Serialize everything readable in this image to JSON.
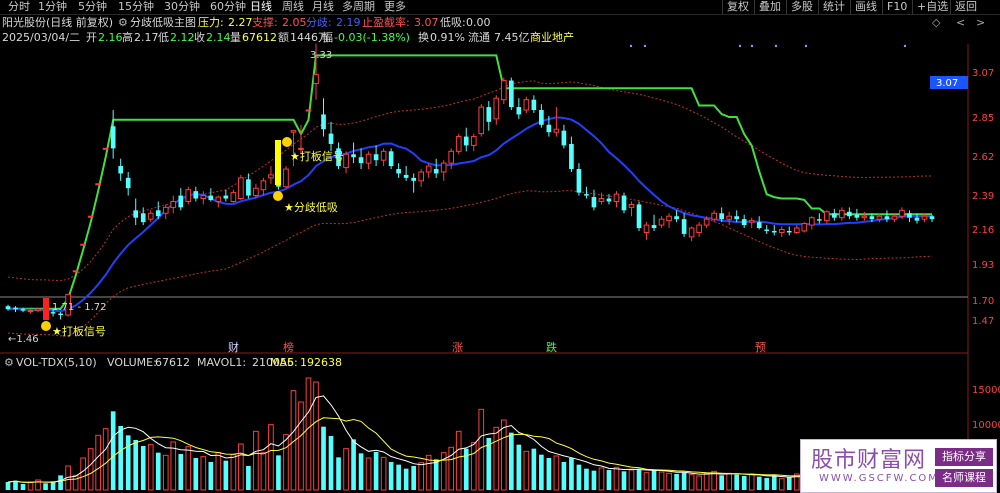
{
  "toolbar": {
    "tabs": [
      "分时",
      "1分钟",
      "5分钟",
      "15分钟",
      "30分钟",
      "60分钟",
      "日线",
      "周线",
      "月线",
      "多周期",
      "更多"
    ],
    "active": "日线",
    "right_buttons": [
      "复权",
      "叠加",
      "多股",
      "统计",
      "画线",
      "F10",
      "+自选",
      "返回"
    ]
  },
  "header": {
    "line1": {
      "stock": "阳光股份(日线 前复权)",
      "indicator": "分歧低吸主图",
      "pressure_label": "压力:",
      "pressure": "2.27",
      "support_label": "支撑:",
      "support": "2.05",
      "split_label": "分歧:",
      "split": "2.19",
      "stop_label": "止盈截率:",
      "stop": "3.07",
      "low_label": "低吸:",
      "low": "0.00"
    },
    "line2": {
      "date": "2025/03/04/二",
      "open_label": "开",
      "open": "2.16",
      "high_label": "高",
      "high": "2.17",
      "lowp_label": "低",
      "lowp": "2.12",
      "close_label": "收",
      "close": "2.14",
      "vol_label": "量",
      "vol": "67612",
      "amt_label": "额",
      "amt": "1446万",
      "chg_label": "幅",
      "chg": "-0.03(-1.38%)",
      "turn_label": "换",
      "turn": "0.91%",
      "float_label": "流通",
      "float": "7.45亿",
      "sector": "商业地产"
    }
  },
  "chart_data": {
    "type": "candlestick",
    "price_axis": {
      "ticks": [
        3.07,
        2.85,
        2.62,
        2.39,
        2.16,
        1.93,
        1.7,
        1.47
      ],
      "labels": [
        "3.07",
        "2.85",
        "2.62",
        "2.39",
        "2.16",
        "1.93",
        "1.70",
        "1.47"
      ],
      "current_label": "3.07",
      "ylim": [
        1.42,
        3.14
      ]
    },
    "volume_axis": {
      "ticks": [
        5000,
        10000,
        15000
      ],
      "labels": [
        "5000",
        "10000",
        "15000"
      ],
      "ylim": [
        0,
        17500
      ]
    },
    "annotations": {
      "high_price": "3.33",
      "low_price": "←1.46",
      "range_label": "1.71 - 1.72",
      "signal_dabang_1": "★打板信号",
      "signal_dabang_2": "★打板信号",
      "signal_fenqi": "★分歧低吸"
    },
    "event_markers": [
      {
        "text": "财",
        "color": "#d8d8ff"
      },
      {
        "text": "榜",
        "color": "#ff5050"
      },
      {
        "text": "涨",
        "color": "#ff5050"
      },
      {
        "text": "跌",
        "color": "#40ff40"
      },
      {
        "text": "预",
        "color": "#ff5050"
      }
    ],
    "volume_legend": {
      "name": "VOL-TDX(5,10)",
      "volume_label": "VOLUME:",
      "volume": "67612",
      "mavol1_label": "MAVOL1:",
      "mavol1": "210056",
      "ma5_label": "MA5:",
      "ma5": "192638"
    },
    "candles": [
      [
        1.55,
        1.56,
        1.52,
        1.53
      ],
      [
        1.54,
        1.55,
        1.51,
        1.53
      ],
      [
        1.53,
        1.54,
        1.51,
        1.52
      ],
      [
        1.52,
        1.53,
        1.5,
        1.52
      ],
      [
        1.52,
        1.54,
        1.51,
        1.53
      ],
      [
        1.53,
        1.54,
        1.5,
        1.51
      ],
      [
        1.51,
        1.53,
        1.48,
        1.5
      ],
      [
        1.5,
        1.51,
        1.46,
        1.49
      ],
      [
        1.49,
        1.63,
        1.48,
        1.63
      ],
      [
        1.79,
        1.79,
        1.79,
        1.79
      ],
      [
        1.97,
        1.97,
        1.97,
        1.97
      ],
      [
        2.16,
        2.16,
        2.16,
        2.16
      ],
      [
        2.38,
        2.38,
        2.38,
        2.38
      ],
      [
        2.62,
        2.62,
        2.62,
        2.62
      ],
      [
        2.77,
        2.88,
        2.55,
        2.62
      ],
      [
        2.5,
        2.55,
        2.4,
        2.45
      ],
      [
        2.42,
        2.46,
        2.3,
        2.35
      ],
      [
        2.2,
        2.28,
        2.1,
        2.15
      ],
      [
        2.18,
        2.22,
        2.1,
        2.12
      ],
      [
        2.14,
        2.2,
        2.12,
        2.18
      ],
      [
        2.2,
        2.26,
        2.14,
        2.16
      ],
      [
        2.18,
        2.24,
        2.14,
        2.22
      ],
      [
        2.22,
        2.3,
        2.18,
        2.26
      ],
      [
        2.3,
        2.35,
        2.2,
        2.22
      ],
      [
        2.26,
        2.36,
        2.24,
        2.34
      ],
      [
        2.33,
        2.36,
        2.26,
        2.28
      ],
      [
        2.28,
        2.33,
        2.24,
        2.3
      ],
      [
        2.3,
        2.35,
        2.26,
        2.27
      ],
      [
        2.26,
        2.3,
        2.22,
        2.29
      ],
      [
        2.3,
        2.34,
        2.26,
        2.28
      ],
      [
        2.26,
        2.34,
        2.25,
        2.32
      ],
      [
        2.28,
        2.44,
        2.27,
        2.42
      ],
      [
        2.41,
        2.45,
        2.28,
        2.3
      ],
      [
        2.3,
        2.38,
        2.28,
        2.35
      ],
      [
        2.34,
        2.42,
        2.3,
        2.4
      ],
      [
        2.42,
        2.5,
        2.38,
        2.44
      ],
      [
        2.4,
        2.46,
        2.34,
        2.36
      ],
      [
        2.36,
        2.5,
        2.35,
        2.48
      ],
      [
        2.73,
        2.74,
        2.5,
        2.74
      ],
      [
        2.62,
        2.78,
        2.58,
        2.62
      ],
      [
        2.88,
        2.88,
        2.88,
        2.88
      ],
      [
        3.06,
        3.33,
        2.95,
        3.12
      ],
      [
        2.85,
        2.96,
        2.7,
        2.75
      ],
      [
        2.72,
        2.8,
        2.6,
        2.65
      ],
      [
        2.62,
        2.66,
        2.48,
        2.5
      ],
      [
        2.49,
        2.6,
        2.45,
        2.58
      ],
      [
        2.58,
        2.66,
        2.52,
        2.56
      ],
      [
        2.56,
        2.62,
        2.48,
        2.52
      ],
      [
        2.52,
        2.6,
        2.48,
        2.58
      ],
      [
        2.58,
        2.64,
        2.5,
        2.54
      ],
      [
        2.54,
        2.62,
        2.5,
        2.6
      ],
      [
        2.6,
        2.62,
        2.48,
        2.5
      ],
      [
        2.48,
        2.52,
        2.42,
        2.45
      ],
      [
        2.44,
        2.5,
        2.4,
        2.42
      ],
      [
        2.42,
        2.45,
        2.32,
        2.4
      ],
      [
        2.4,
        2.48,
        2.36,
        2.46
      ],
      [
        2.46,
        2.52,
        2.42,
        2.5
      ],
      [
        2.48,
        2.55,
        2.42,
        2.45
      ],
      [
        2.46,
        2.54,
        2.4,
        2.52
      ],
      [
        2.52,
        2.62,
        2.48,
        2.6
      ],
      [
        2.6,
        2.72,
        2.58,
        2.7
      ],
      [
        2.7,
        2.76,
        2.6,
        2.64
      ],
      [
        2.64,
        2.72,
        2.6,
        2.7
      ],
      [
        2.72,
        2.92,
        2.7,
        2.9
      ],
      [
        2.9,
        2.94,
        2.74,
        2.8
      ],
      [
        2.82,
        2.98,
        2.78,
        2.96
      ],
      [
        2.95,
        3.1,
        2.92,
        3.08
      ],
      [
        3.08,
        3.1,
        2.88,
        2.9
      ],
      [
        2.9,
        2.96,
        2.82,
        2.85
      ],
      [
        2.88,
        2.97,
        2.86,
        2.95
      ],
      [
        2.95,
        2.98,
        2.86,
        2.88
      ],
      [
        2.88,
        2.92,
        2.76,
        2.78
      ],
      [
        2.78,
        2.84,
        2.7,
        2.73
      ],
      [
        2.73,
        2.9,
        2.7,
        2.75
      ],
      [
        2.74,
        2.78,
        2.62,
        2.64
      ],
      [
        2.65,
        2.7,
        2.46,
        2.48
      ],
      [
        2.48,
        2.52,
        2.3,
        2.32
      ],
      [
        2.31,
        2.36,
        2.28,
        2.3
      ],
      [
        2.29,
        2.34,
        2.2,
        2.22
      ],
      [
        2.26,
        2.32,
        2.24,
        2.28
      ],
      [
        2.28,
        2.31,
        2.24,
        2.26
      ],
      [
        2.26,
        2.33,
        2.22,
        2.31
      ],
      [
        2.3,
        2.32,
        2.18,
        2.2
      ],
      [
        2.22,
        2.26,
        2.16,
        2.24
      ],
      [
        2.24,
        2.26,
        2.06,
        2.08
      ],
      [
        2.05,
        2.12,
        2.0,
        2.1
      ],
      [
        2.1,
        2.17,
        2.06,
        2.08
      ],
      [
        2.1,
        2.16,
        2.08,
        2.14
      ],
      [
        2.13,
        2.18,
        2.08,
        2.16
      ],
      [
        2.16,
        2.2,
        2.12,
        2.14
      ],
      [
        2.14,
        2.18,
        2.02,
        2.04
      ],
      [
        2.02,
        2.09,
        1.99,
        2.08
      ],
      [
        2.05,
        2.12,
        2.02,
        2.1
      ],
      [
        2.1,
        2.16,
        2.08,
        2.14
      ],
      [
        2.14,
        2.2,
        2.12,
        2.18
      ],
      [
        2.18,
        2.22,
        2.12,
        2.14
      ],
      [
        2.14,
        2.19,
        2.1,
        2.16
      ],
      [
        2.16,
        2.2,
        2.12,
        2.14
      ],
      [
        2.14,
        2.17,
        2.08,
        2.1
      ],
      [
        2.12,
        2.15,
        2.08,
        2.13
      ],
      [
        2.12,
        2.16,
        2.07,
        2.08
      ],
      [
        2.07,
        2.1,
        2.04,
        2.06
      ],
      [
        2.06,
        2.1,
        2.03,
        2.05
      ],
      [
        2.05,
        2.09,
        2.02,
        2.07
      ],
      [
        2.06,
        2.09,
        2.03,
        2.05
      ],
      [
        2.05,
        2.1,
        2.04,
        2.08
      ],
      [
        2.06,
        2.12,
        2.05,
        2.11
      ],
      [
        2.1,
        2.16,
        2.07,
        2.15
      ],
      [
        2.14,
        2.18,
        2.11,
        2.13
      ],
      [
        2.13,
        2.2,
        2.11,
        2.19
      ],
      [
        2.18,
        2.21,
        2.13,
        2.15
      ],
      [
        2.15,
        2.22,
        2.13,
        2.2
      ],
      [
        2.19,
        2.22,
        2.14,
        2.16
      ],
      [
        2.17,
        2.21,
        2.13,
        2.15
      ],
      [
        2.15,
        2.19,
        2.13,
        2.16
      ],
      [
        2.16,
        2.18,
        2.12,
        2.14
      ],
      [
        2.14,
        2.18,
        2.12,
        2.16
      ],
      [
        2.16,
        2.2,
        2.12,
        2.14
      ],
      [
        2.14,
        2.18,
        2.12,
        2.16
      ],
      [
        2.16,
        2.22,
        2.14,
        2.2
      ],
      [
        2.18,
        2.2,
        2.12,
        2.15
      ],
      [
        2.15,
        2.18,
        2.11,
        2.13
      ],
      [
        2.14,
        2.18,
        2.12,
        2.16
      ],
      [
        2.16,
        2.17,
        2.12,
        2.14
      ]
    ],
    "volumes": [
      1200,
      1400,
      900,
      1100,
      1500,
      1000,
      1300,
      2200,
      3600,
      2200,
      4800,
      6200,
      8200,
      9200,
      11800,
      9600,
      8200,
      7500,
      6600,
      6800,
      5600,
      5200,
      7200,
      5400,
      6500,
      4800,
      5000,
      4200,
      5600,
      4400,
      5300,
      6900,
      3600,
      8800,
      5600,
      9800,
      5200,
      8300,
      14900,
      13200,
      16800,
      16200,
      9500,
      8100,
      4900,
      6200,
      7600,
      5500,
      4800,
      5700,
      4900,
      4200,
      3800,
      3200,
      3600,
      4100,
      5200,
      4600,
      5600,
      6400,
      8800,
      6200,
      7100,
      12100,
      7800,
      9400,
      10500,
      8600,
      6800,
      5800,
      6200,
      5300,
      4800,
      5100,
      4200,
      4800,
      3800,
      3200,
      2900,
      3300,
      3000,
      3400,
      2800,
      3000,
      3200,
      2600,
      3100,
      2700,
      2500,
      2400,
      2600,
      2300,
      2100,
      2500,
      2800,
      2200,
      2500,
      2300,
      2100,
      2400,
      2000,
      1800,
      2200,
      1700,
      1900,
      2400,
      2000,
      2800,
      2200,
      2600,
      2300,
      2500,
      2000,
      2200,
      1900,
      2100,
      2000,
      2300,
      2100,
      2600,
      1900,
      1800,
      2000,
      1700
    ]
  },
  "watermark": {
    "title": "股市财富网",
    "url": "WWW.GSCFW.COM",
    "tag1": "指标分享",
    "tag2": "名师课程"
  }
}
